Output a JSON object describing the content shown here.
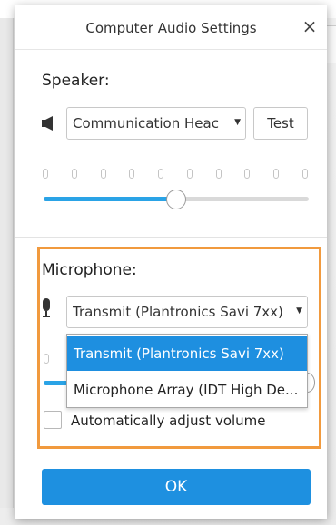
{
  "dialog": {
    "title": "Computer Audio Settings",
    "close_label": "×"
  },
  "speaker": {
    "label": "Speaker:",
    "device_selected": "Communication Heac",
    "test_label": "Test",
    "volume_level": 0.5,
    "meter_tick_count": 10
  },
  "microphone": {
    "label": "Microphone:",
    "device_selected": "Transmit (Plantronics Savi 7xx)",
    "dropdown_options": [
      "Transmit (Plantronics Savi 7xx)",
      "Microphone Array (IDT High De..."
    ],
    "auto_adjust_label": "Automatically adjust volume",
    "auto_adjust_checked": false
  },
  "ok_label": "OK",
  "colors": {
    "accent": "#1e90e0",
    "highlight_border": "#f19a3e",
    "slider_fill": "#2aa3e6"
  },
  "icons": {
    "speaker": "speaker-icon",
    "microphone": "microphone-icon",
    "dropdown": "chevron-down-icon",
    "close": "close-icon"
  }
}
